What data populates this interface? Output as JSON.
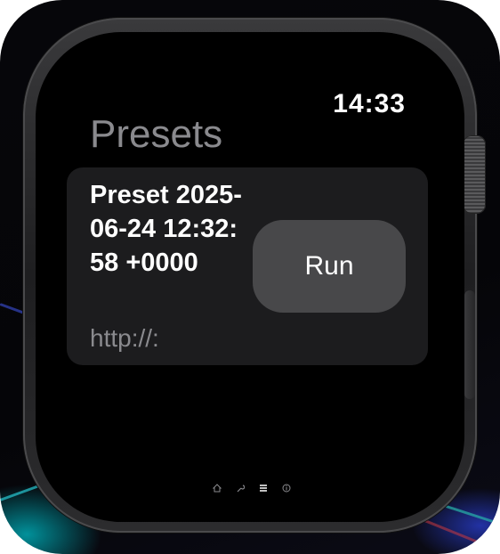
{
  "status": {
    "time": "14:33"
  },
  "page": {
    "title": "Presets"
  },
  "preset": {
    "name": "Preset 2025-06-24 12:32:58 +0000",
    "url": "http://:",
    "run_label": "Run"
  },
  "page_indicator": {
    "icons": [
      "home-icon",
      "wrench-icon",
      "list-icon",
      "info-icon"
    ],
    "active_index": 2
  }
}
